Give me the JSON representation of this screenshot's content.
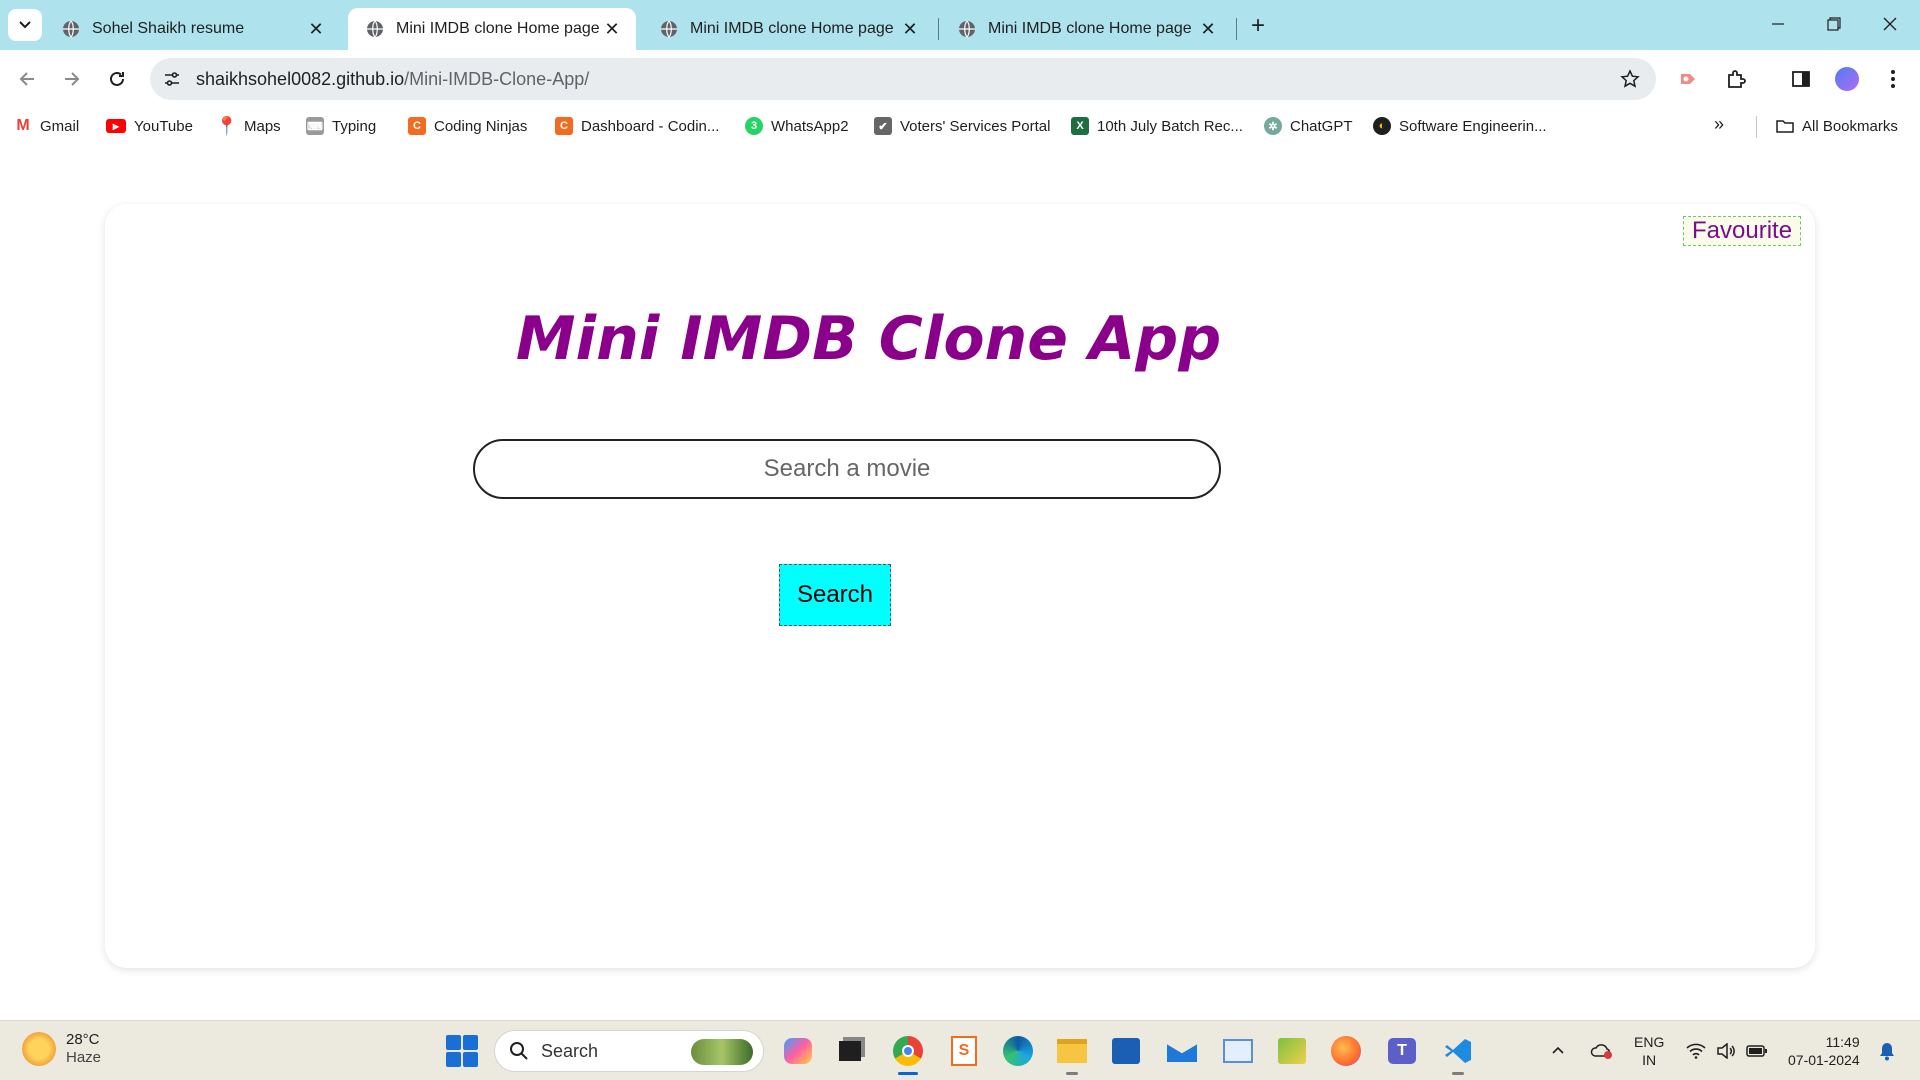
{
  "browser": {
    "tabs": [
      {
        "title": "Sohel Shaikh resume",
        "active": false
      },
      {
        "title": "Mini IMDB clone Home page",
        "active": true
      },
      {
        "title": "Mini IMDB clone Home page",
        "active": false
      },
      {
        "title": "Mini IMDB clone Home page",
        "active": false
      }
    ],
    "url_host": "shaikhsohel0082.github.io",
    "url_path": "/Mini-IMDB-Clone-App/",
    "bookmarks": [
      {
        "label": "Gmail",
        "icon": "gmail-icon",
        "color": "#ea4335"
      },
      {
        "label": "YouTube",
        "icon": "youtube-icon",
        "color": "#ff0000"
      },
      {
        "label": "Maps",
        "icon": "maps-icon",
        "color": "#34a853"
      },
      {
        "label": "Typing",
        "icon": "typing-icon",
        "color": "#777777"
      },
      {
        "label": "Coding Ninjas",
        "icon": "coding-ninjas-icon",
        "color": "#f26b21"
      },
      {
        "label": "Dashboard - Codin...",
        "icon": "coding-ninjas-icon",
        "color": "#f26b21"
      },
      {
        "label": "WhatsApp2",
        "icon": "whatsapp-icon",
        "color": "#25d366"
      },
      {
        "label": "Voters' Services Portal",
        "icon": "voters-portal-icon",
        "color": "#666666"
      },
      {
        "label": "10th July Batch Rec...",
        "icon": "excel-icon",
        "color": "#1d6f42"
      },
      {
        "label": "ChatGPT",
        "icon": "chatgpt-icon",
        "color": "#74aa9c"
      },
      {
        "label": "Software Engineerin...",
        "icon": "software-eng-icon",
        "color": "#1f1f1f"
      }
    ],
    "all_bookmarks_label": "All Bookmarks"
  },
  "app": {
    "favourite_label": "Favourite",
    "title": "Mini IMDB Clone App",
    "search_placeholder": "Search a movie",
    "search_button_label": "Search",
    "title_color": "#8b008b",
    "button_color": "#00ffff"
  },
  "taskbar": {
    "temperature": "28°C",
    "weather": "Haze",
    "search_label": "Search",
    "lang_top": "ENG",
    "lang_bottom": "IN",
    "time": "11:49",
    "date": "07-01-2024"
  }
}
